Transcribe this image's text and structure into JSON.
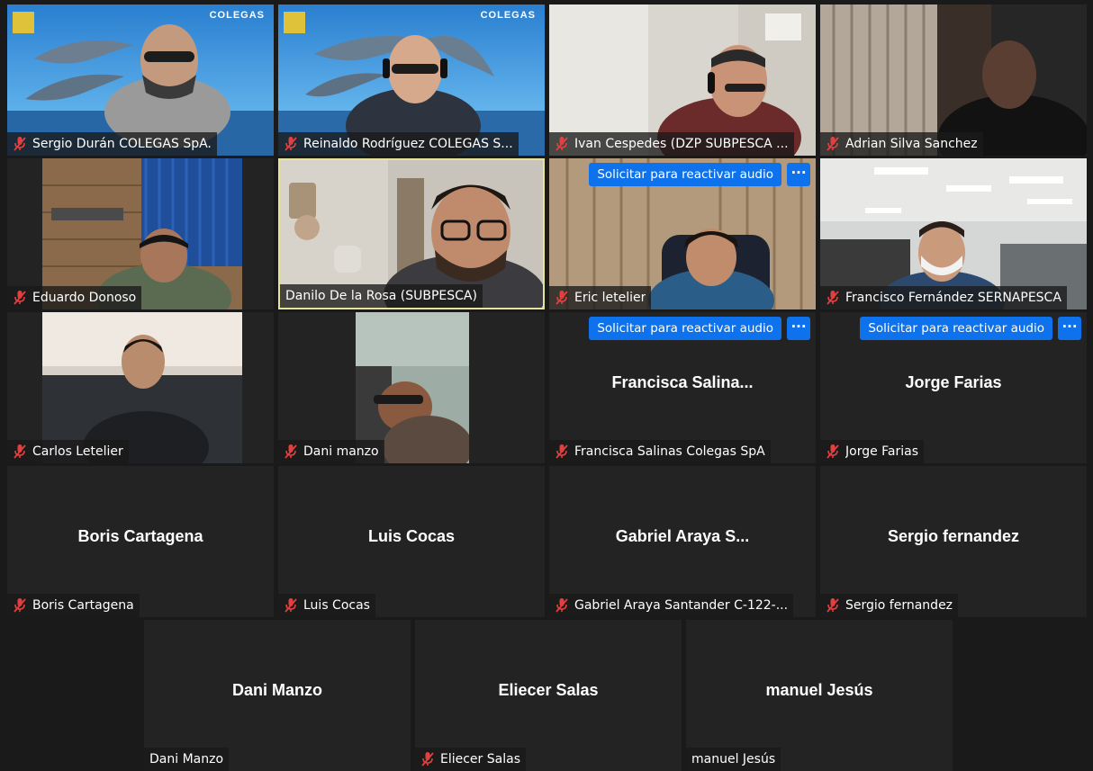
{
  "meeting": {
    "request_audio_label": "Solicitar para reactivar audio",
    "more_label": "···",
    "colors": {
      "background": "#1a1a1a",
      "tile": "#232323",
      "accent_blue": "#0e72ed",
      "mute_red": "#e23f3f",
      "active_border": "#e6e39a"
    }
  },
  "video_overlay": {
    "brand_text": "COLEGAS"
  },
  "participants": [
    {
      "label": "Sergio Durán COLEGAS SpA.",
      "muted": true
    },
    {
      "label": "Reinaldo Rodríguez  COLEGAS S...",
      "muted": true
    },
    {
      "label": "Ivan Cespedes (DZP SUBPESCA ...",
      "muted": true
    },
    {
      "label": "Adrian Silva Sanchez",
      "muted": true
    },
    {
      "label": "Eduardo Donoso",
      "muted": true
    },
    {
      "label": "Danilo De la Rosa (SUBPESCA)",
      "muted": false,
      "active": true
    },
    {
      "label": "Eric letelier",
      "muted": true
    },
    {
      "label": "Francisco Fernández SERNAPESCA",
      "muted": true
    },
    {
      "label": "Carlos Letelier",
      "muted": true
    },
    {
      "label": "Dani manzo",
      "muted": true
    },
    {
      "label": "Francisca Salinas Colegas SpA",
      "display_name": "Francisca  Salina...",
      "muted": true
    },
    {
      "label": "Jorge Farias",
      "display_name": "Jorge Farias",
      "muted": true
    },
    {
      "label": "Boris Cartagena",
      "display_name": "Boris Cartagena",
      "muted": true
    },
    {
      "label": "Luis Cocas",
      "display_name": "Luis Cocas",
      "muted": true
    },
    {
      "label": "Gabriel Araya Santander C-122-...",
      "display_name": "Gabriel  Araya  S...",
      "muted": true
    },
    {
      "label": "Sergio fernandez",
      "display_name": "Sergio fernandez",
      "muted": true
    },
    {
      "label": "Dani Manzo",
      "display_name": "Dani Manzo",
      "muted": false
    },
    {
      "label": "Eliecer Salas",
      "display_name": "Eliecer Salas",
      "muted": true
    },
    {
      "label": "manuel Jesús",
      "display_name": "manuel Jesús",
      "muted": false
    }
  ]
}
